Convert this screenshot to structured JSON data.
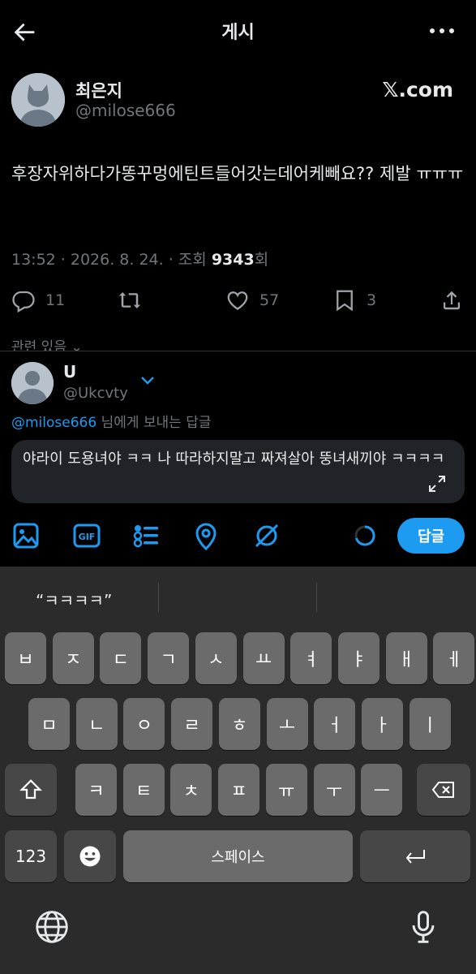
{
  "header": {
    "title": "게시"
  },
  "post": {
    "author_name": "최은지",
    "author_handle": "@milose666",
    "brand": "𝕏.com",
    "text": "후장자위하다가똥꾸멍에틴트들어갓는데어케빼요?? 제발 ㅠㅠㅠ",
    "time_date": "13:52 · 2026. 8. 24. · 조회 ",
    "views": "9343",
    "views_suffix": "회",
    "replies": "11",
    "likes": "57",
    "bookmarks": "3",
    "related_label": "관련 있음"
  },
  "reply": {
    "user_name": "U",
    "user_handle": "@Ukcvty",
    "reply_to_mention": "@milose666",
    "reply_to_suffix": " 님에게 보내는 답글",
    "text": "야라이 도용녀야 ㅋㅋ 나 따라하지말고 짜져살아 뚱녀새끼야 ㅋㅋㅋㅋ",
    "button_label": "답글"
  },
  "keyboard": {
    "suggestion": "“ㅋㅋㅋㅋ”",
    "row1": [
      "ㅂ",
      "ㅈ",
      "ㄷ",
      "ㄱ",
      "ㅅ",
      "ㅛ",
      "ㅕ",
      "ㅑ",
      "ㅐ",
      "ㅔ"
    ],
    "row2": [
      "ㅁ",
      "ㄴ",
      "ㅇ",
      "ㄹ",
      "ㅎ",
      "ㅗ",
      "ㅓ",
      "ㅏ",
      "ㅣ"
    ],
    "row3": [
      "ㅋ",
      "ㅌ",
      "ㅊ",
      "ㅍ",
      "ㅠ",
      "ㅜ",
      "ㅡ"
    ],
    "numbers_label": "123",
    "space_label": "스페이스"
  },
  "colors": {
    "accent": "#1d9bf0",
    "muted": "#71767b",
    "background": "#000000"
  }
}
